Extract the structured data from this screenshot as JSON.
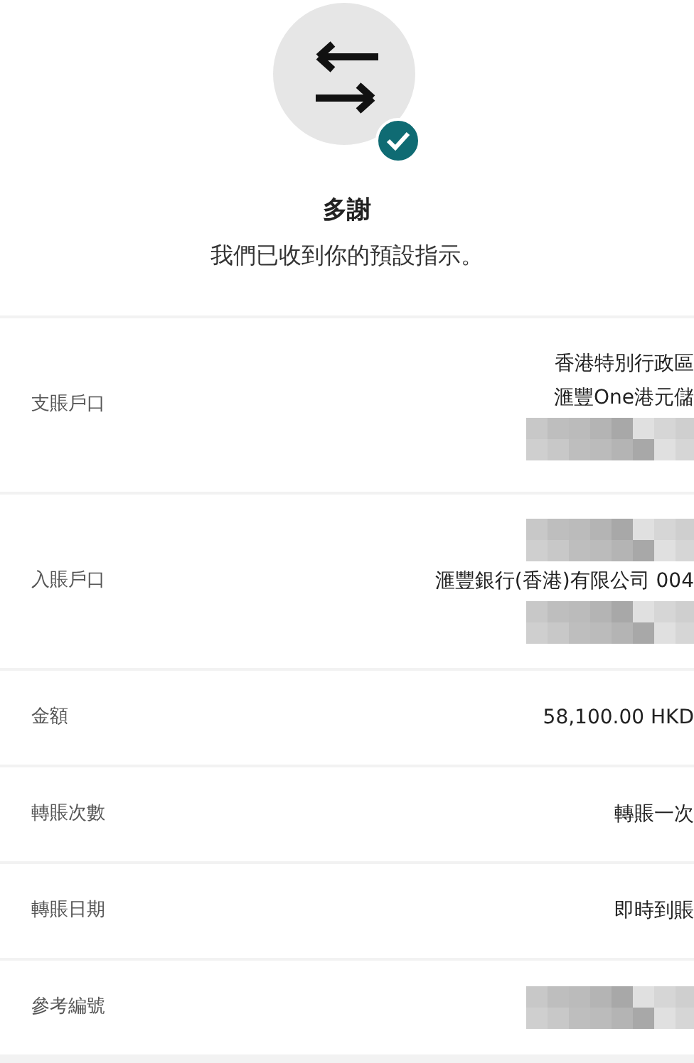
{
  "header": {
    "title": "多謝",
    "message": "我們已收到你的預設指示。"
  },
  "rows": [
    {
      "label": "支賬戶口",
      "values": [
        {
          "kind": "text",
          "text": "香港特別行政區"
        },
        {
          "kind": "text",
          "text": "滙豐One港元儲"
        },
        {
          "kind": "redacted"
        }
      ]
    },
    {
      "label": "入賬戶口",
      "values": [
        {
          "kind": "redacted"
        },
        {
          "kind": "text",
          "text": "滙豐銀行(香港)有限公司 004"
        },
        {
          "kind": "redacted"
        }
      ]
    },
    {
      "label": "金額",
      "values": [
        {
          "kind": "text",
          "text": "58,100.00 HKD"
        }
      ]
    },
    {
      "label": "轉賬次數",
      "values": [
        {
          "kind": "text",
          "text": "轉賬一次"
        }
      ]
    },
    {
      "label": "轉賬日期",
      "values": [
        {
          "kind": "text",
          "text": "即時到賬"
        }
      ]
    },
    {
      "label": "參考編號",
      "values": [
        {
          "kind": "redacted"
        }
      ]
    }
  ]
}
